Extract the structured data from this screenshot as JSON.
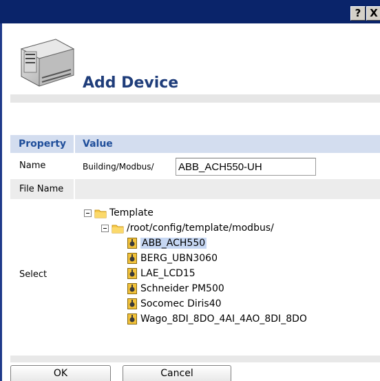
{
  "window": {
    "help_button": "?",
    "close_button": "X"
  },
  "header": {
    "title": "Add Device",
    "icon": "din-rail-device-icon"
  },
  "table": {
    "col_property": "Property",
    "col_value": "Value",
    "rows": {
      "name_label": "Name",
      "name_prefix": "Building/Modbus/",
      "name_value": "ABB_ACH550-UH",
      "file_name_label": "File Name",
      "select_label": "Select"
    }
  },
  "tree": {
    "root": "Template",
    "folder": "/root/config/template/modbus/",
    "items": [
      "ABB_ACH550",
      "BERG_UBN3060",
      "LAE_LCD15",
      "Schneider PM500",
      "Socomec Diris40",
      "Wago_8DI_8DO_4AI_4AO_8DI_8DO"
    ],
    "selected_item": "ABB_ACH550"
  },
  "buttons": {
    "ok": "OK",
    "cancel": "Cancel"
  },
  "colors": {
    "titlebar": "#0a246a",
    "header_row": "#d3ddef",
    "title_text": "#1f3d7a",
    "selection": "#c6d7f3"
  }
}
